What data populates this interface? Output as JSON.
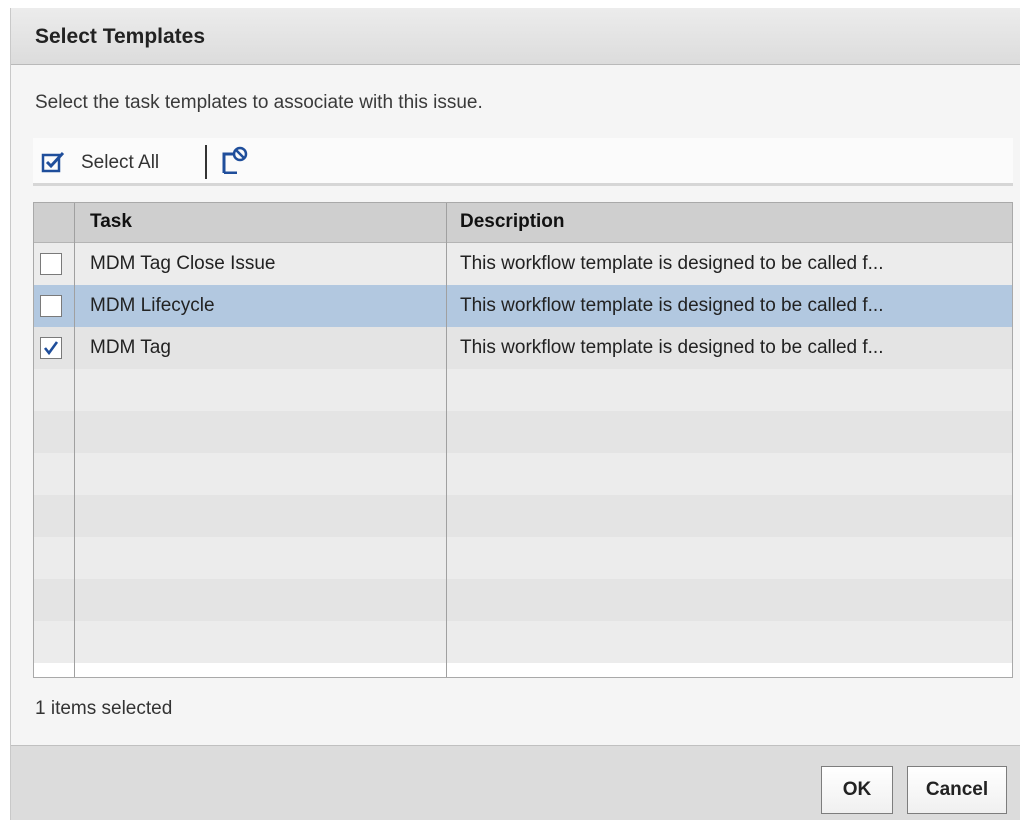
{
  "dialog": {
    "title": "Select Templates",
    "instructions": "Select the task templates to associate with this issue."
  },
  "toolbar": {
    "select_all_label": "Select All",
    "select_all_icon": "select-all-checkbox-icon",
    "filter_icon": "filter-icon"
  },
  "table": {
    "columns": [
      "Task",
      "Description"
    ],
    "rows": [
      {
        "task": "MDM Tag Close Issue",
        "description": "This workflow template is designed to be called f...",
        "checked": false,
        "highlighted": false
      },
      {
        "task": "MDM Lifecycle",
        "description": "This workflow template is designed to be called f...",
        "checked": false,
        "highlighted": true
      },
      {
        "task": "MDM Tag",
        "description": "This workflow template is designed to be called f...",
        "checked": true,
        "highlighted": false
      }
    ]
  },
  "status": "1 items selected",
  "buttons": {
    "ok": "OK",
    "cancel": "Cancel"
  },
  "colors": {
    "highlight_row": "#b2c8e0",
    "accent_icon": "#1f4e9b"
  }
}
